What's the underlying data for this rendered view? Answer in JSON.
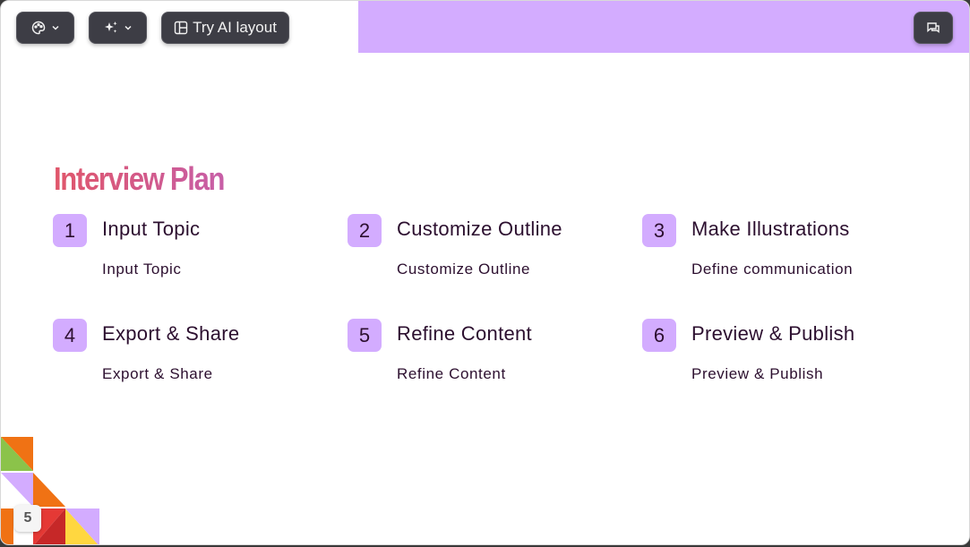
{
  "toolbar": {
    "theme_icon": "palette-icon",
    "ai_icon": "sparkles-icon",
    "layout_icon": "layout-icon",
    "layout_label": "Try AI layout",
    "chat_icon": "chat-icon"
  },
  "slide": {
    "title": "Interview Plan",
    "accent_color": "#d3acff",
    "text_color": "#2c0f2f",
    "title_gradient": [
      "#e0566a",
      "#c75ea7"
    ],
    "steps": [
      {
        "number": "1",
        "heading": "Input Topic",
        "description": "Input Topic"
      },
      {
        "number": "2",
        "heading": "Customize Outline",
        "description": "Customize Outline"
      },
      {
        "number": "3",
        "heading": "Make Illustrations",
        "description": "Define communication"
      },
      {
        "number": "4",
        "heading": "Export & Share",
        "description": "Export & Share"
      },
      {
        "number": "5",
        "heading": "Refine Content",
        "description": "Refine Content"
      },
      {
        "number": "6",
        "heading": "Preview & Publish",
        "description": "Preview & Publish"
      }
    ]
  },
  "page_number": "5"
}
